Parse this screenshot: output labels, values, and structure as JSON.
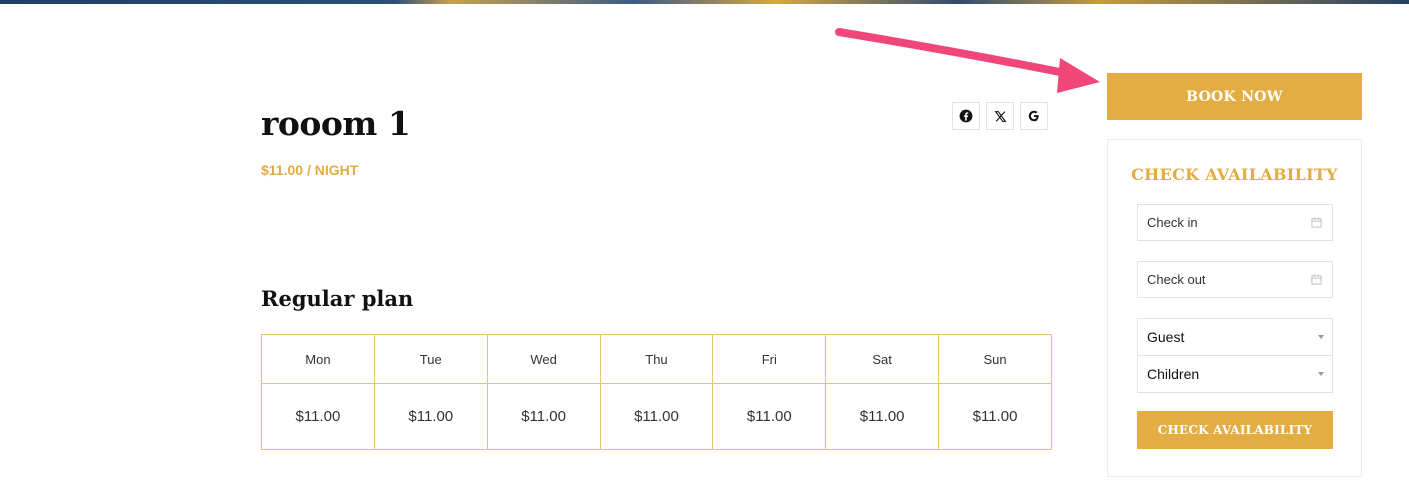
{
  "room": {
    "title": "rooom 1",
    "price": "$11.00 / NIGHT"
  },
  "share": [
    {
      "icon": "facebook-icon"
    },
    {
      "icon": "x-icon"
    },
    {
      "icon": "google-icon"
    }
  ],
  "plan": {
    "title": "Regular plan",
    "days": [
      "Mon",
      "Tue",
      "Wed",
      "Thu",
      "Fri",
      "Sat",
      "Sun"
    ],
    "prices": [
      "$11.00",
      "$11.00",
      "$11.00",
      "$11.00",
      "$11.00",
      "$11.00",
      "$11.00"
    ]
  },
  "booking": {
    "book_now_label": "BOOK NOW",
    "availability_title": "CHECK AVAILABILITY",
    "check_in_placeholder": "Check in",
    "check_out_placeholder": "Check out",
    "guest_label": "Guest",
    "children_label": "Children",
    "check_button_label": "CHECK AVAILABILITY"
  },
  "colors": {
    "accent": "#e4ad43",
    "arrow": "#f0477a",
    "table_border": "#e8c270"
  }
}
